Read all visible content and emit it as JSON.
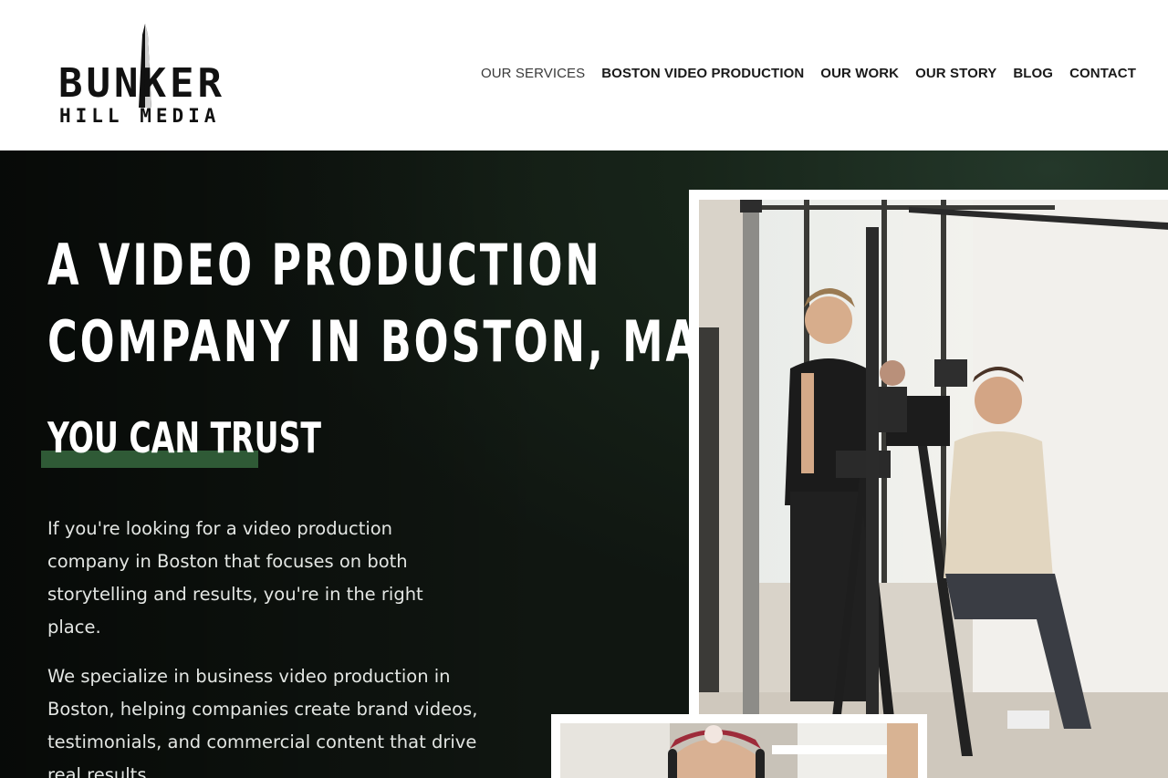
{
  "brand": {
    "name_line1": "BUNKER",
    "name_line2": "HILL MEDIA"
  },
  "nav": {
    "items": [
      {
        "label": "OUR SERVICES"
      },
      {
        "label": "BOSTON VIDEO PRODUCTION"
      },
      {
        "label": "OUR WORK"
      },
      {
        "label": "OUR STORY"
      },
      {
        "label": "BLOG"
      },
      {
        "label": "CONTACT"
      }
    ]
  },
  "hero": {
    "headline_line1": "A VIDEO PRODUCTION",
    "headline_line2": "COMPANY IN BOSTON, MA",
    "subhead": "YOU CAN TRUST",
    "paragraph1": "If you're looking for a video production company in Boston that focuses on both storytelling and results, you're in the right place.",
    "paragraph2": "We specialize in business video production in Boston, helping companies create brand videos, testimonials, and commercial content that drive real results."
  },
  "colors": {
    "hero_bg": "#111812",
    "accent_green": "#2f5a36",
    "text_light": "#ffffff",
    "nav_text": "#1a1a1a"
  }
}
